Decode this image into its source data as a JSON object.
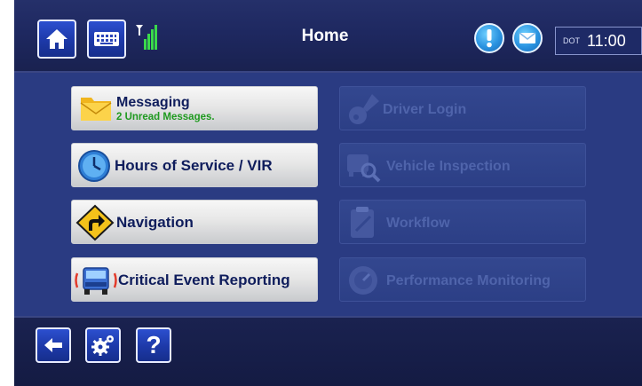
{
  "header": {
    "title": "Home",
    "clock_prefix": "DOT",
    "time": "11:00"
  },
  "menu": {
    "left": [
      {
        "label": "Messaging",
        "sublabel": "2 Unread Messages.",
        "icon": "envelope-icon"
      },
      {
        "label": "Hours of Service / VIR",
        "icon": "clock-icon"
      },
      {
        "label": "Navigation",
        "icon": "turn-sign-icon"
      },
      {
        "label": "Critical Event Reporting",
        "icon": "truck-alert-icon"
      }
    ],
    "right": [
      {
        "label": "Driver Login",
        "icon": "key-icon",
        "enabled": false
      },
      {
        "label": "Vehicle Inspection",
        "icon": "inspection-icon",
        "enabled": false
      },
      {
        "label": "Workflow",
        "icon": "clipboard-icon",
        "enabled": false
      },
      {
        "label": "Performance Monitoring",
        "icon": "gauge-icon",
        "enabled": false
      }
    ]
  },
  "footer": {
    "help_label": "?"
  },
  "colors": {
    "header_bg": "#1e2860",
    "content_bg": "#2a3b82",
    "button_blue": "#1d39a8",
    "unread_green": "#1f9a1f",
    "disabled_text": "#4f64ab"
  }
}
